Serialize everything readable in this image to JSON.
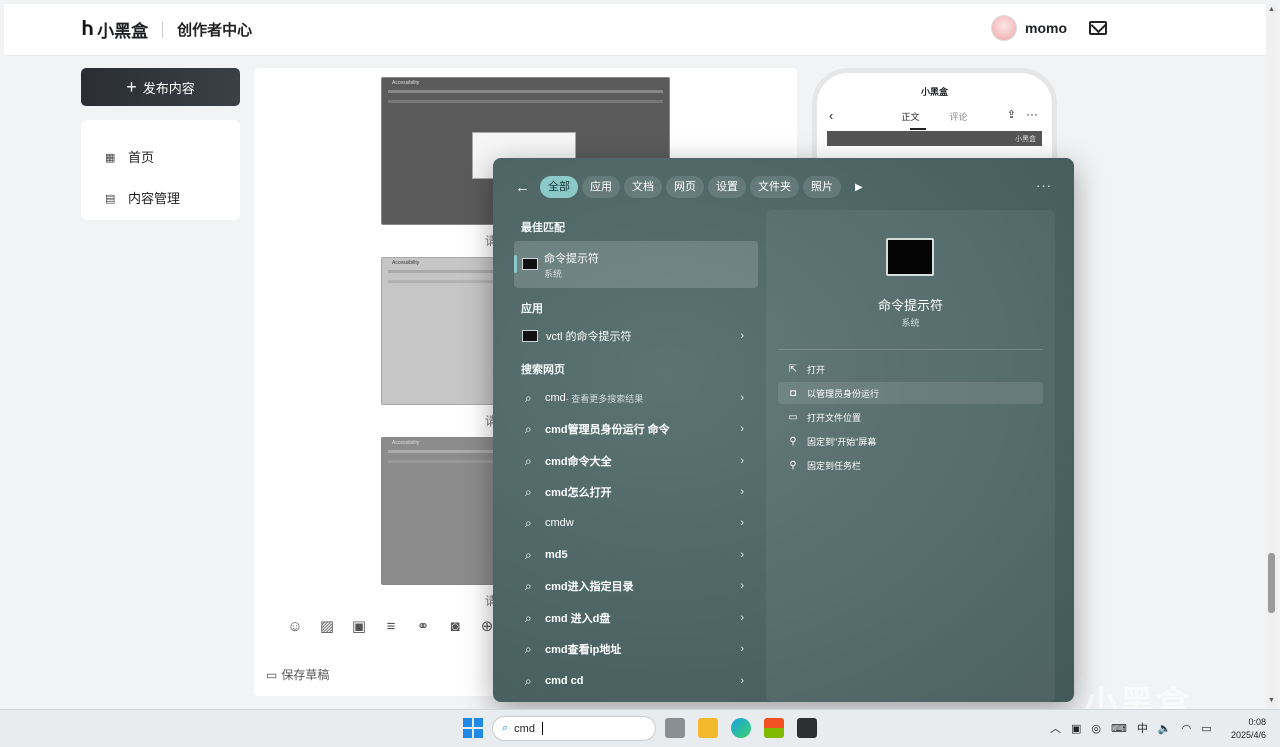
{
  "header": {
    "logo_mark": "Ⴙ",
    "brand": "小黑盒",
    "section": "创作者中心",
    "username": "momo"
  },
  "sidebar": {
    "publish_label": "发布内容",
    "items": [
      {
        "label": "首页"
      },
      {
        "label": "内容管理"
      }
    ]
  },
  "editor": {
    "captions": [
      "请",
      "请",
      "请"
    ],
    "save_label": "保存草稿",
    "thumb_title": "Accessibility"
  },
  "phone_preview": {
    "brand": "小黑盒",
    "tabs": [
      "正文",
      "评论"
    ],
    "banner": "小黑盒"
  },
  "start_menu": {
    "filters": [
      "全部",
      "应用",
      "文档",
      "网页",
      "设置",
      "文件夹",
      "照片"
    ],
    "best_match_header": "最佳匹配",
    "best_match": {
      "name": "命令提示符",
      "type": "系统"
    },
    "apps_header": "应用",
    "apps": [
      {
        "label": "vctl 的命令提示符"
      }
    ],
    "web_header": "搜索网页",
    "web_results": [
      {
        "bold": "cmd",
        "sub": " - 查看更多搜索结果"
      },
      {
        "bold": "cmd管理员身份运行 命令",
        "sub": ""
      },
      {
        "bold": "cmd命令大全",
        "sub": ""
      },
      {
        "bold": "cmd怎么打开",
        "sub": ""
      },
      {
        "bold": "cmdw",
        "sub": ""
      },
      {
        "bold": "md5",
        "sub": ""
      },
      {
        "bold": "cmd进入指定目录",
        "sub": ""
      },
      {
        "bold": "cmd 进入d盘",
        "sub": ""
      },
      {
        "bold": "cmd查看ip地址",
        "sub": ""
      },
      {
        "bold": "cmd cd",
        "sub": ""
      }
    ],
    "detail": {
      "name": "命令提示符",
      "type": "系统"
    },
    "actions": [
      {
        "label": "打开",
        "icon": "open-icon"
      },
      {
        "label": "以管理员身份运行",
        "icon": "shield-icon"
      },
      {
        "label": "打开文件位置",
        "icon": "folder-icon"
      },
      {
        "label": "固定到\"开始\"屏幕",
        "icon": "pin-icon"
      },
      {
        "label": "固定到任务栏",
        "icon": "pin-icon"
      }
    ]
  },
  "taskbar": {
    "search_text": "cmd",
    "time": "0:08",
    "date": "2025/4/6",
    "ime": "中"
  },
  "watermark": "小黑盒",
  "colors": {
    "accent": "#8ccaca",
    "menu_bg": "#4d6565",
    "publish_bg": "#2a2e33"
  }
}
